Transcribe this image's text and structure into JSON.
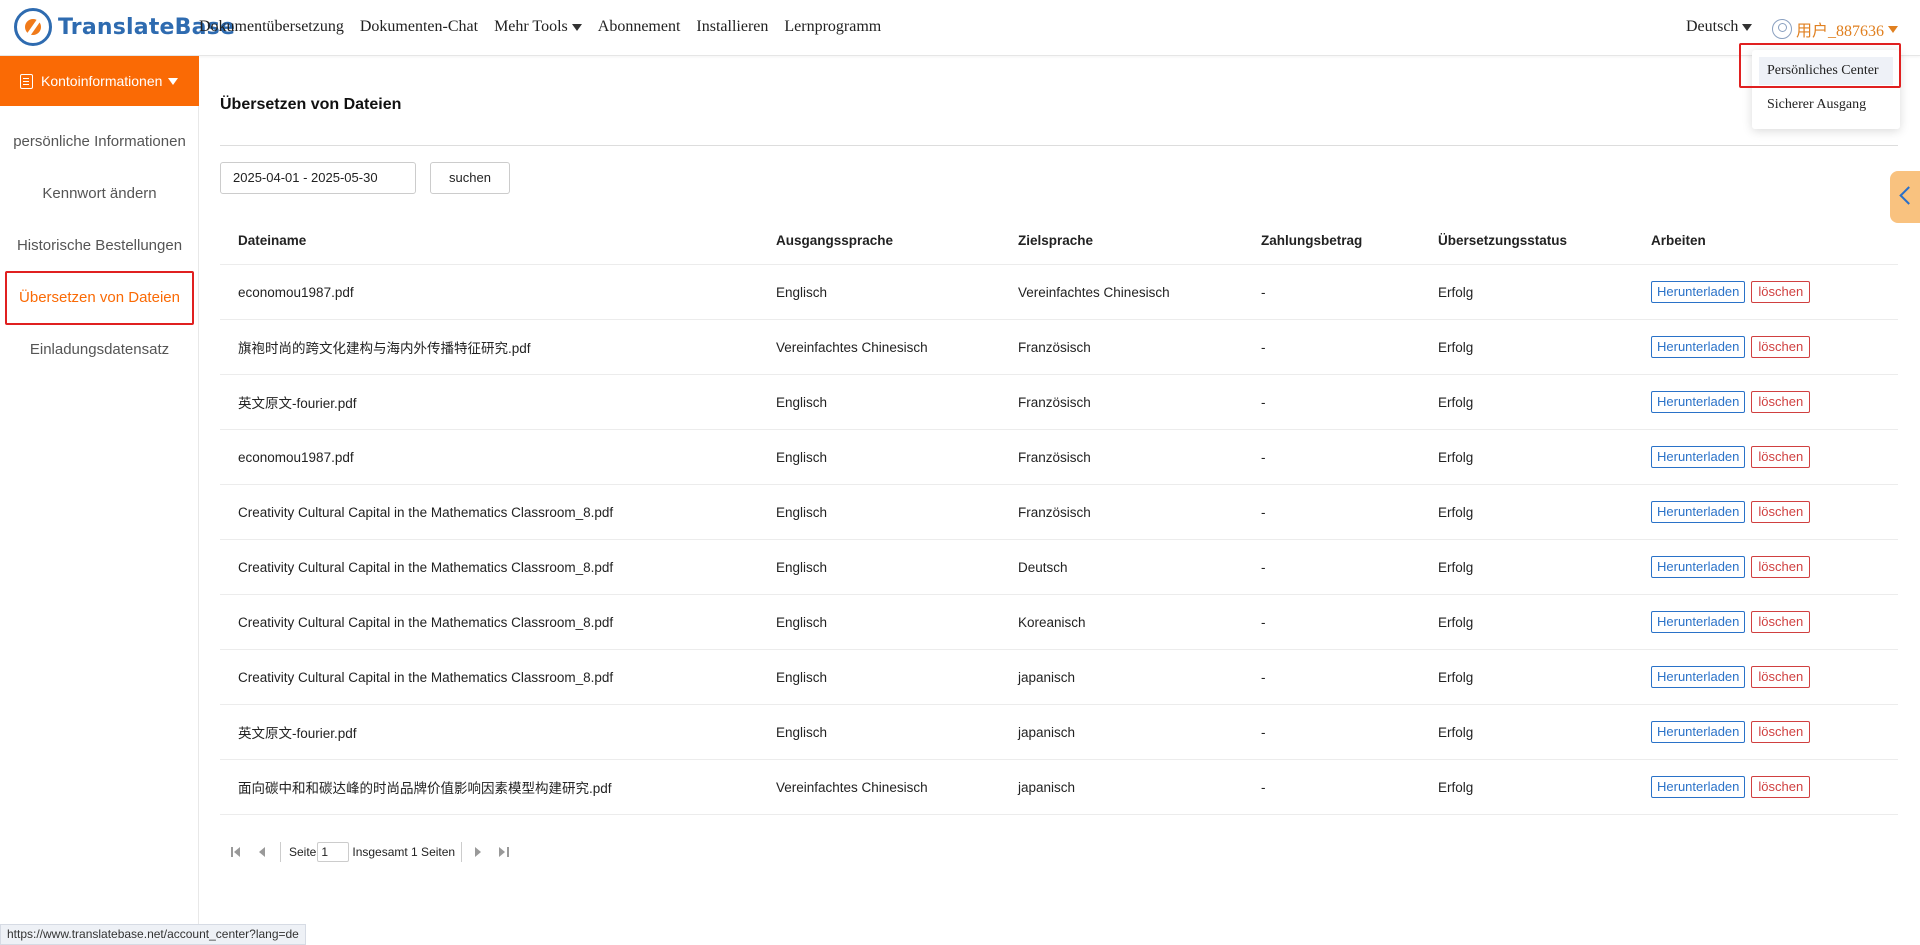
{
  "brand": {
    "name": "TranslateBase"
  },
  "nav": {
    "items": [
      {
        "label": "Dokumentübersetzung"
      },
      {
        "label": "Dokumenten-Chat"
      },
      {
        "label": "Mehr Tools",
        "dropdown": true
      },
      {
        "label": "Abonnement"
      },
      {
        "label": "Installieren"
      },
      {
        "label": "Lernprogramm"
      }
    ],
    "language": "Deutsch",
    "user": "用户_887636"
  },
  "user_menu": {
    "items": [
      "Persönliches Center",
      "Sicherer Ausgang"
    ]
  },
  "sidebar": {
    "header": "Kontoinformationen",
    "items": [
      "persönliche Informationen",
      "Kennwort ändern",
      "Historische Bestellungen",
      "Übersetzen von Dateien",
      "Einladungsdatensatz"
    ],
    "active_index": 3
  },
  "main": {
    "title": "Übersetzen von Dateien",
    "date_range": "2025-04-01 - 2025-05-30",
    "search_label": "suchen",
    "columns": [
      "Dateiname",
      "Ausgangssprache",
      "Zielsprache",
      "Zahlungsbetrag",
      "Übersetzungsstatus",
      "Arbeiten"
    ],
    "download_label": "Herunterladen",
    "delete_label": "löschen",
    "rows": [
      [
        "economou1987.pdf",
        "Englisch",
        "Vereinfachtes Chinesisch",
        "-",
        "Erfolg"
      ],
      [
        "旗袍时尚的跨文化建构与海内外传播特征研究.pdf",
        "Vereinfachtes Chinesisch",
        "Französisch",
        "-",
        "Erfolg"
      ],
      [
        "英文原文-fourier.pdf",
        "Englisch",
        "Französisch",
        "-",
        "Erfolg"
      ],
      [
        "economou1987.pdf",
        "Englisch",
        "Französisch",
        "-",
        "Erfolg"
      ],
      [
        "Creativity Cultural Capital in the Mathematics Classroom_8.pdf",
        "Englisch",
        "Französisch",
        "-",
        "Erfolg"
      ],
      [
        "Creativity Cultural Capital in the Mathematics Classroom_8.pdf",
        "Englisch",
        "Deutsch",
        "-",
        "Erfolg"
      ],
      [
        "Creativity Cultural Capital in the Mathematics Classroom_8.pdf",
        "Englisch",
        "Koreanisch",
        "-",
        "Erfolg"
      ],
      [
        "Creativity Cultural Capital in the Mathematics Classroom_8.pdf",
        "Englisch",
        "japanisch",
        "-",
        "Erfolg"
      ],
      [
        "英文原文-fourier.pdf",
        "Englisch",
        "japanisch",
        "-",
        "Erfolg"
      ],
      [
        "面向碳中和和碳达峰的时尚品牌价值影响因素模型构建研究.pdf",
        "Vereinfachtes Chinesisch",
        "japanisch",
        "-",
        "Erfolg"
      ]
    ]
  },
  "pagination": {
    "page_label": "Seite",
    "current_page": "1",
    "total_label": "Insgesamt 1 Seiten"
  },
  "status_bar": {
    "url": "https://www.translatebase.net/account_center?lang=de"
  },
  "colors": {
    "accent": "#fa6a05",
    "link_blue": "#2a72c8",
    "delete_red": "#d04040",
    "highlight": "#e02020"
  }
}
